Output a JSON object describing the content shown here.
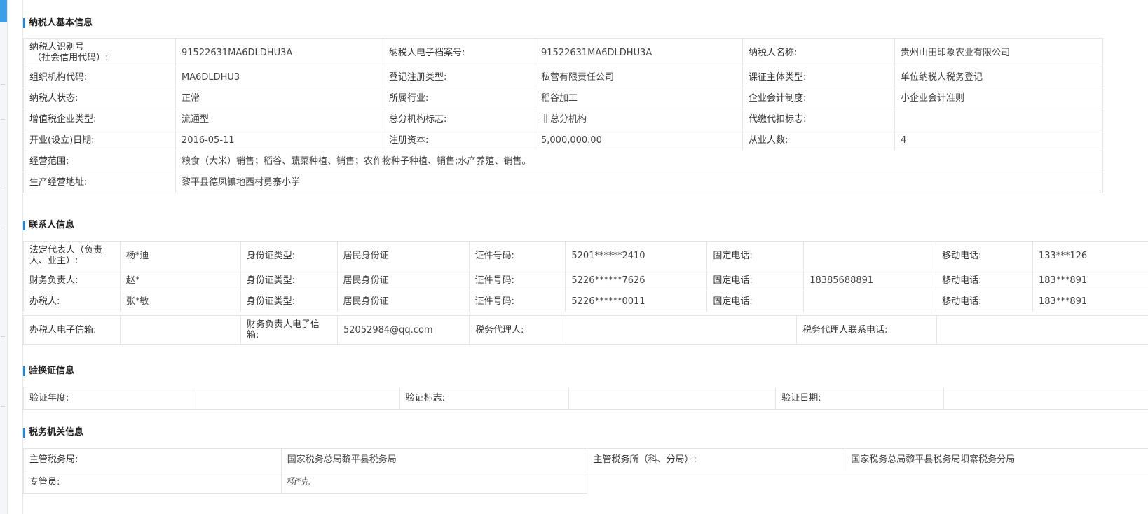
{
  "basic": {
    "title": "纳税人基本信息",
    "rows": [
      [
        "纳税人识别号\n（社会信用代码）:",
        "91522631MA6DLDHU3A",
        "纳税人电子档案号:",
        "91522631MA6DLDHU3A",
        "纳税人名称:",
        "贵州山田印象农业有限公司"
      ],
      [
        "组织机构代码:",
        "MA6DLDHU3",
        "登记注册类型:",
        "私营有限责任公司",
        "课征主体类型:",
        "单位纳税人税务登记"
      ],
      [
        "纳税人状态:",
        "正常",
        "所属行业:",
        "稻谷加工",
        "企业会计制度:",
        "小企业会计准则"
      ],
      [
        "增值税企业类型:",
        "流通型",
        "总分机构标志:",
        "非总分机构",
        "代缴代扣标志:",
        ""
      ],
      [
        "开业(设立)日期:",
        "2016-05-11",
        "注册资本:",
        "5,000,000.00",
        "从业人数:",
        "4"
      ]
    ],
    "scope_label": "经营范围:",
    "scope_value": "粮食（大米）销售；稻谷、蔬菜种植、销售；农作物种子种植、销售;水产养殖、销售。",
    "address_label": "生产经营地址:",
    "address_value": "黎平县德凤镇地西村勇寨小学"
  },
  "contacts": {
    "title": "联系人信息",
    "rows": [
      [
        "法定代表人（负责人、业主）:",
        "杨*迪",
        "身份证类型:",
        "居民身份证",
        "证件号码:",
        "5201******2410",
        "固定电话:",
        "",
        "移动电话:",
        "133***126"
      ],
      [
        "财务负责人:",
        "赵*",
        "身份证类型:",
        "居民身份证",
        "证件号码:",
        "5226******7626",
        "固定电话:",
        "18385688891",
        "移动电话:",
        "183***891"
      ],
      [
        "办税人:",
        "张*敏",
        "身份证类型:",
        "居民身份证",
        "证件号码:",
        "5226******0011",
        "固定电话:",
        "",
        "移动电话:",
        "183***891"
      ]
    ],
    "email_row": [
      "办税人电子信箱:",
      "",
      "财务负责人电子信箱:",
      "52052984@qq.com",
      "税务代理人:",
      "",
      "税务代理人联系电话:",
      ""
    ]
  },
  "verify": {
    "title": "验换证信息",
    "row": [
      "验证年度:",
      "",
      "验证标志:",
      "",
      "验证日期:",
      ""
    ]
  },
  "tax_office": {
    "title": "税务机关信息",
    "row1": [
      "主管税务局:",
      "国家税务总局黎平县税务局",
      "主管税务所（科、分局）:",
      "国家税务总局黎平县税务局坝寨税务分局"
    ],
    "row2": [
      "专管员:",
      "杨*克"
    ]
  }
}
